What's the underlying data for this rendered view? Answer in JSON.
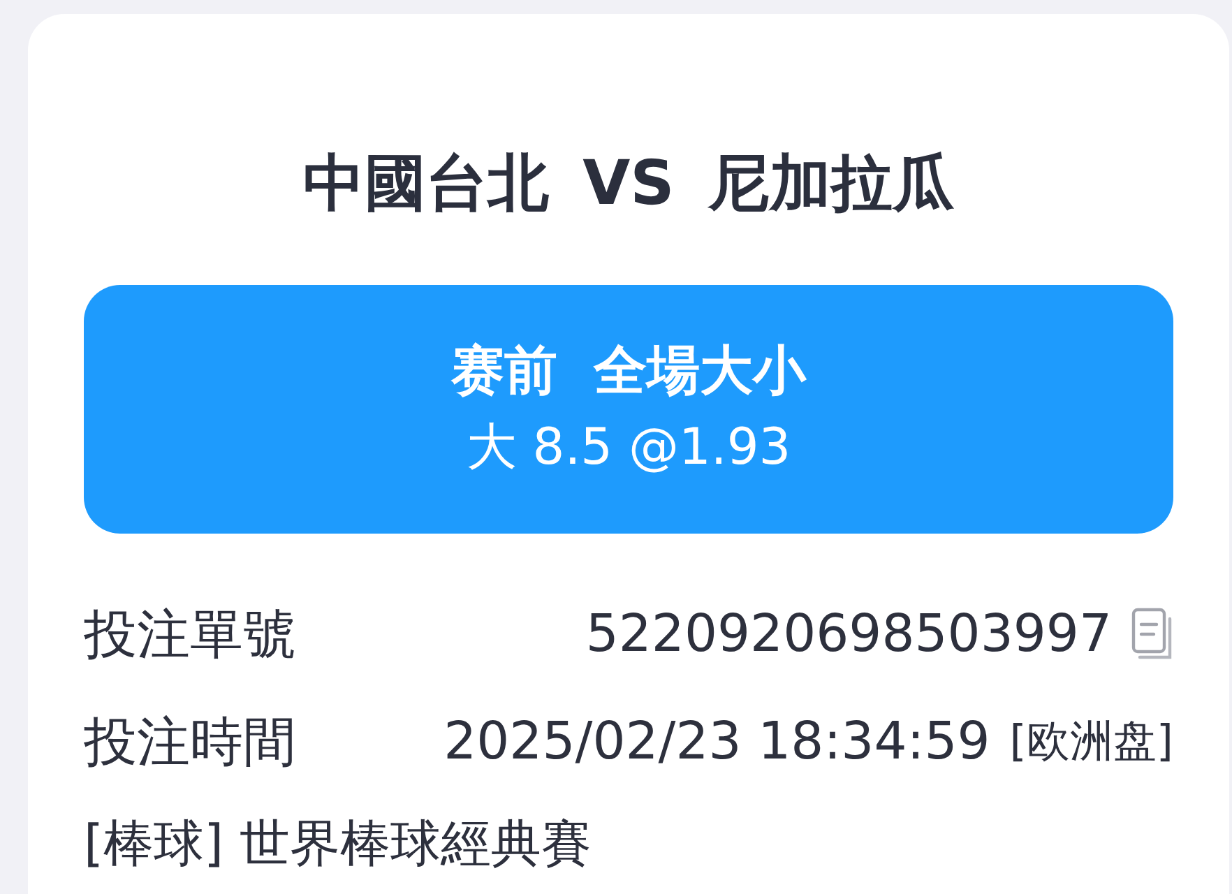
{
  "match": {
    "home": "中國台北",
    "vs": "VS",
    "away": "尼加拉瓜"
  },
  "bet": {
    "stage": "赛前",
    "market": "全場大小",
    "selection": "大 8.5 @1.93"
  },
  "details": [
    {
      "label": "投注單號",
      "value": "5220920698503997",
      "copyable": true
    },
    {
      "label": "投注時間",
      "value": "2025/02/23 18:34:59",
      "tag": "[欧洲盘]",
      "copyable": false
    }
  ],
  "league": "[棒球] 世界棒球經典賽"
}
